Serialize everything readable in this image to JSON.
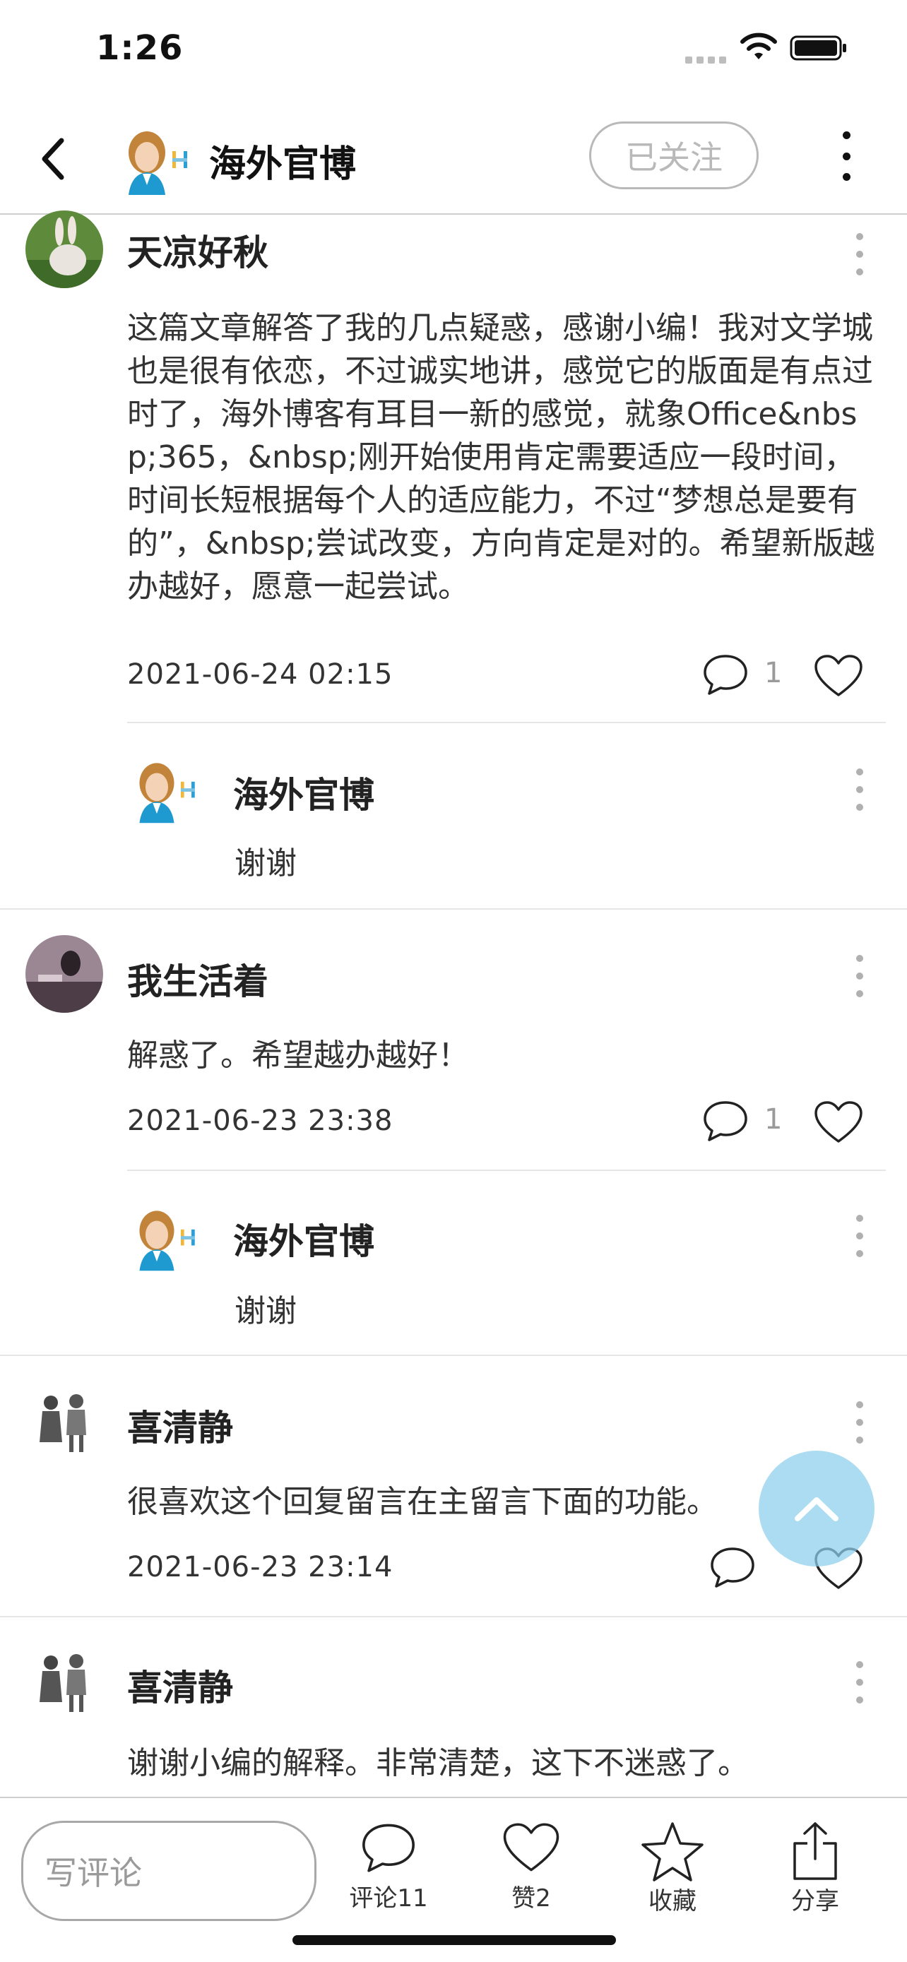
{
  "status_bar": {
    "time": "1:26"
  },
  "header": {
    "title": "海外官博",
    "follow_label": "已关注"
  },
  "comments": [
    {
      "author": "天凉好秋",
      "text": "这篇文章解答了我的几点疑惑，感谢小编！我对文学城也是很有依恋，不过诚实地讲，感觉它的版面是有点过时了，海外博客有耳目一新的感觉，就象Office&nbsp;365，&nbsp;刚开始使用肯定需要适应一段时间，时间长短根据每个人的适应能力，不过“梦想总是要有的”，&nbsp;尝试改变，方向肯定是对的。希望新版越办越好，愿意一起尝试。",
      "date": "2021-06-24 02:15",
      "reply_count": "1",
      "reply": {
        "author": "海外官博",
        "text": "谢谢"
      }
    },
    {
      "author": "我生活着",
      "text": "解惑了。希望越办越好！",
      "date": "2021-06-23 23:38",
      "reply_count": "1",
      "reply": {
        "author": "海外官博",
        "text": "谢谢"
      }
    },
    {
      "author": "喜清静",
      "text": "很喜欢这个回复留言在主留言下面的功能。",
      "date": "2021-06-23 23:14"
    },
    {
      "author": "喜清静",
      "text": "谢谢小编的解释。非常清楚，这下不迷惑了。"
    }
  ],
  "bottom_bar": {
    "input_placeholder": "写评论",
    "comments_label": "评论11",
    "likes_label": "赞2",
    "favorite_label": "收藏",
    "share_label": "分享"
  },
  "colors": {
    "accent_up_button": "#8bceec",
    "follow_border": "#b9b9b9"
  },
  "icons": [
    "back-icon",
    "more-icon",
    "comment-icon",
    "heart-icon",
    "star-icon",
    "share-icon",
    "chevron-up-icon",
    "wifi-icon",
    "battery-icon"
  ]
}
